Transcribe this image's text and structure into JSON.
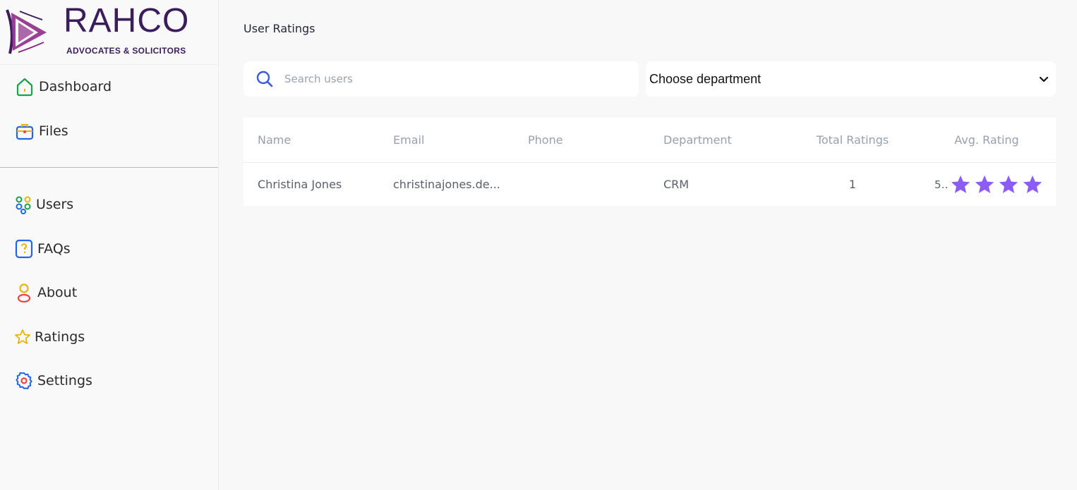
{
  "brand": {
    "name": "RAHCO",
    "tagline": "ADVOCATES & SOLICITORS",
    "colors": {
      "primary": "#3b1d5c",
      "accent": "#8e2a88"
    }
  },
  "sidebar": {
    "top_items": [
      {
        "label": "Dashboard",
        "icon": "home-icon"
      },
      {
        "label": "Files",
        "icon": "briefcase-icon"
      }
    ],
    "items": [
      {
        "label": "Users",
        "icon": "users-icon"
      },
      {
        "label": "FAQs",
        "icon": "question-icon"
      },
      {
        "label": "About",
        "icon": "person-icon"
      },
      {
        "label": "Ratings",
        "icon": "star-icon"
      },
      {
        "label": "Settings",
        "icon": "gear-icon"
      }
    ]
  },
  "page": {
    "title": "User Ratings"
  },
  "search": {
    "placeholder": "Search users",
    "value": ""
  },
  "department_select": {
    "value": "Choose department"
  },
  "table": {
    "headers": {
      "name": "Name",
      "email": "Email",
      "phone": "Phone",
      "department": "Department",
      "total_ratings": "Total Ratings",
      "avg_rating": "Avg. Rating"
    },
    "rows": [
      {
        "name": "Christina Jones",
        "email": "christinajones.de...",
        "phone": "",
        "department": "CRM",
        "total_ratings": "1",
        "avg_rating": "5...",
        "stars_shown": 4,
        "star_color": "#8b5cf6"
      }
    ]
  }
}
